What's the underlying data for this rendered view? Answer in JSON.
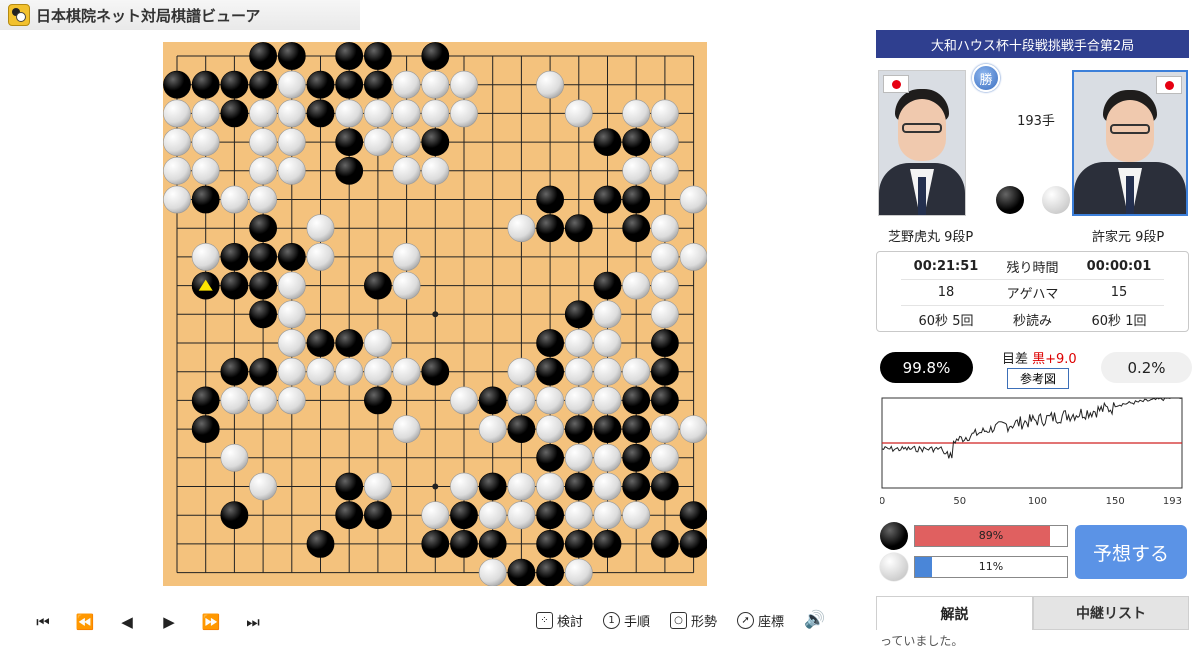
{
  "app": {
    "title": "日本棋院ネット対局棋譜ビューア"
  },
  "match": {
    "title": "大和ハウス杯十段戦挑戦手合第2局",
    "move_count": "193手",
    "win_badge": "勝"
  },
  "players": {
    "black": {
      "name": "芝野虎丸 9段P",
      "time": "00:21:51",
      "captures": "18",
      "byoyomi": "60秒 5回",
      "win_rate": "99.8%",
      "bar_label": "89%",
      "bar_value": 0.89
    },
    "white": {
      "name": "許家元 9段P",
      "time": "00:00:01",
      "captures": "15",
      "byoyomi": "60秒 1回",
      "win_rate": "0.2%",
      "bar_label": "11%",
      "bar_value": 0.11
    }
  },
  "info_labels": {
    "time_left": "残り時間",
    "captures": "アゲハマ",
    "byoyomi": "秒読み"
  },
  "analysis": {
    "margin_label": "目差 ",
    "margin_value": "黒+9.0",
    "reference_button": "参考図",
    "predict_button": "予想する"
  },
  "graph": {
    "x_ticks": [
      "0",
      "50",
      "100",
      "150",
      "193"
    ],
    "colors": {
      "line": "#222222",
      "baseline": "#d02020"
    }
  },
  "toolbar": {
    "nav": [
      "⏮",
      "⏪",
      "◀",
      "▶",
      "⏩",
      "⏭"
    ],
    "review": "検討",
    "order": "手順",
    "situation": "形勢",
    "coordinates": "座標",
    "sound_icon": "🔊"
  },
  "tabs": {
    "commentary": "解説",
    "relay_list": "中継リスト"
  },
  "commentary_snippet": "っていました。",
  "board": {
    "size": 19,
    "last_move": [
      1,
      8
    ],
    "last_move_marker_color": "#ffe600",
    "rows": [
      "...BB.BB.B.........",
      "BBBBWBBBWWW..W.....",
      "WWBWWBWWWWW...W.WW.",
      "WW.WW.BWWB.....BBW.",
      "WW.WW.B.WW......WW.",
      "WBWW.........B.BB.W",
      "...B.W......WBB.BW.",
      ".WBBBW..W........WW",
      ".BBBW..BW......BWW.",
      "...BW.........BW.W.",
      "....WBBW.....BWW.B.",
      "..BBWWWWWB..WBWWWB.",
      ".BWWW..B..WBWWWWBB.",
      ".B......W..WBWBBBWW",
      "..W..........BWWBW.",
      "...W..BW..WBWWBWBB.",
      "..B...BB.WBWWBWWW.B",
      ".....B...BBB.BBB.BB",
      "...........WBBW...."
    ]
  }
}
